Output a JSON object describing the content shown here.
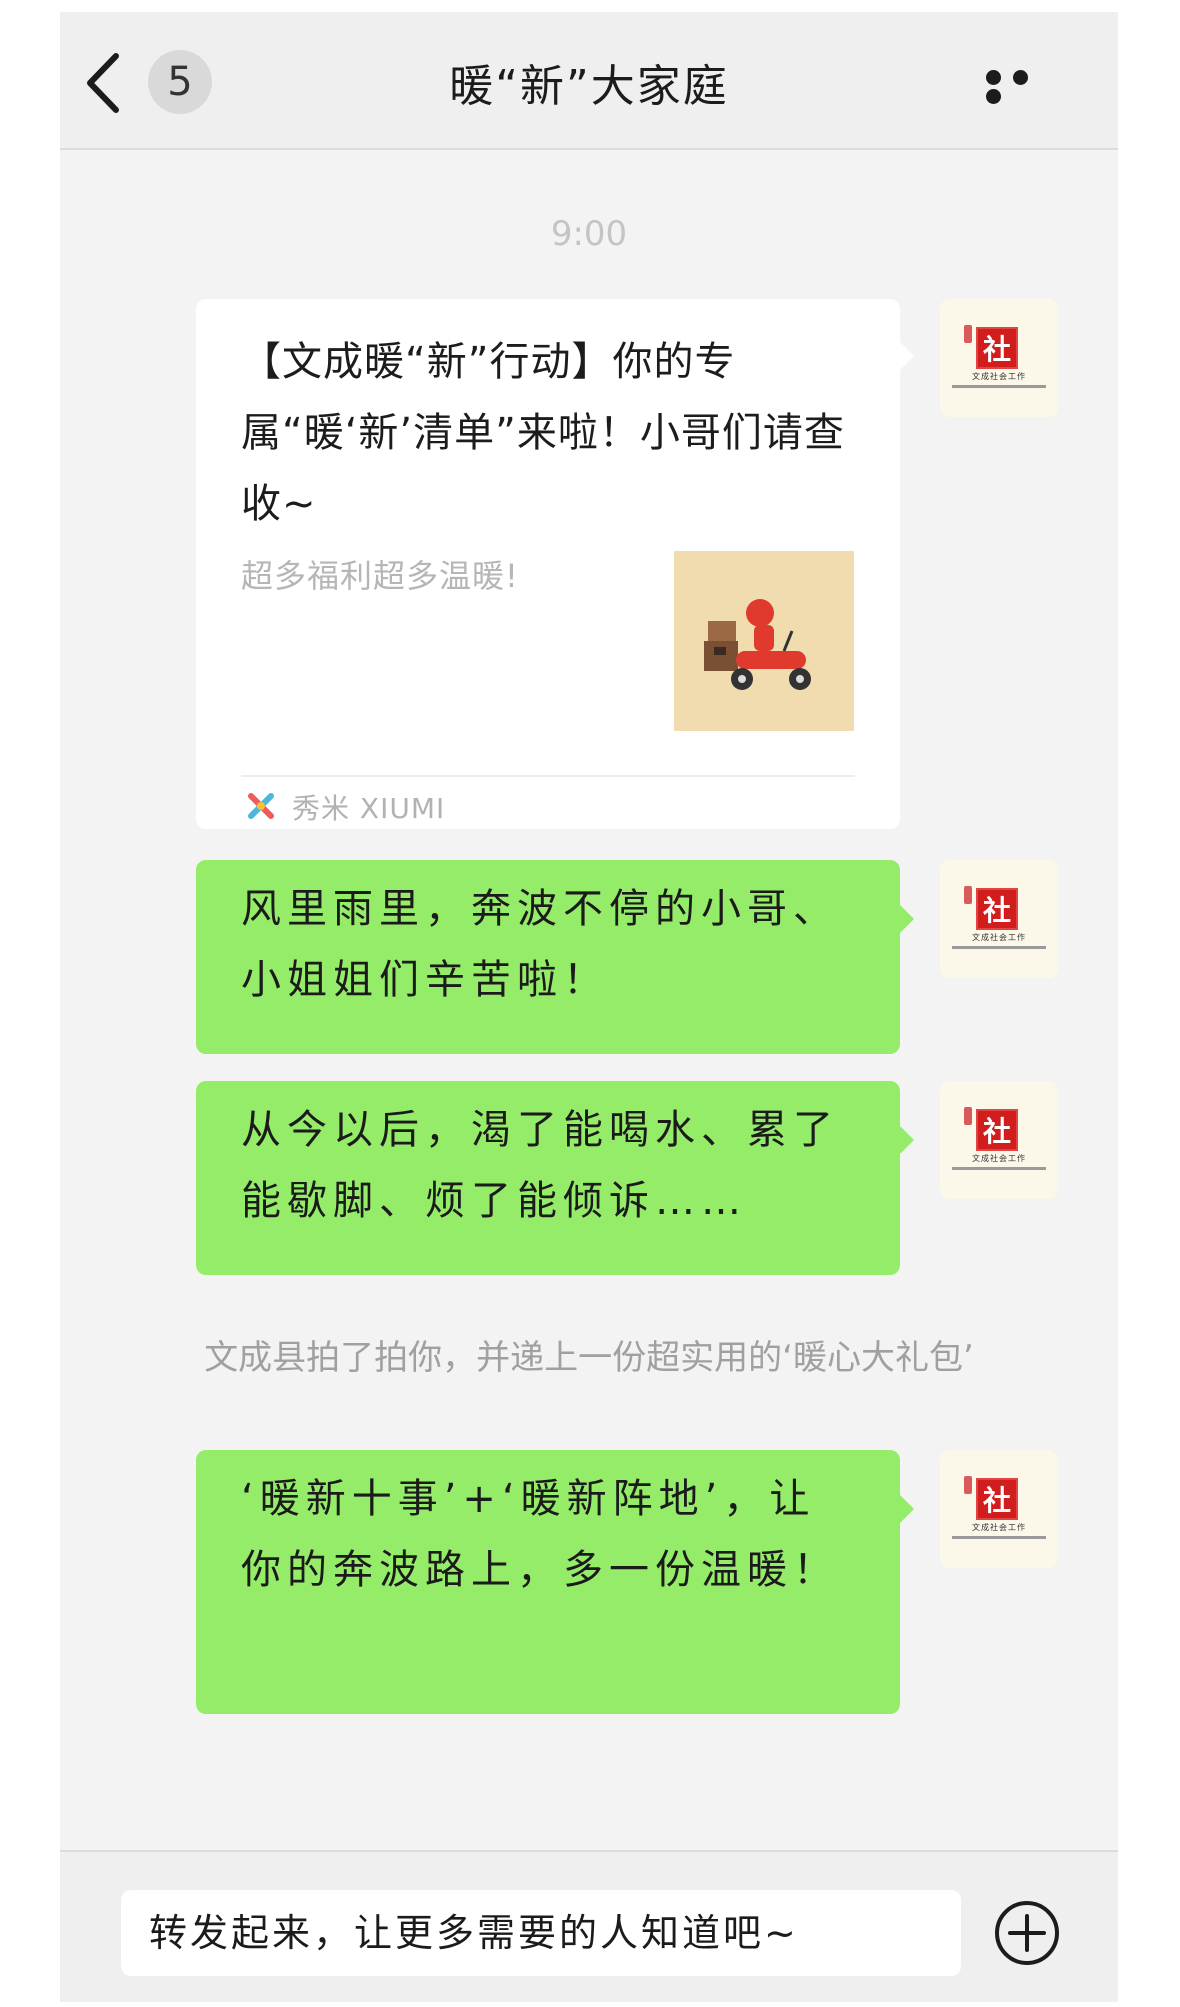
{
  "header": {
    "back_icon": "chevron-left-icon",
    "unread_count": "5",
    "title": "暖“新”大家庭",
    "more_icon": "more-dots-icon"
  },
  "timestamp": "9:00",
  "card": {
    "title": "【文成暖“新”行动】你的专属“暖‘新’清单”来啦！小哥们请查收~",
    "description": "超多福利超多温暖!",
    "source": "秀米 XIUMI",
    "thumbnail_icon": "delivery-scooter-illustration",
    "avatar_text": "社"
  },
  "messages": [
    {
      "text": "风里雨里，奔波不停的小哥、小姐姐们辛苦啦！",
      "avatar_text": "社"
    },
    {
      "text": "从今以后，渴了能喝水、累了能歇脚、烦了能倾诉……",
      "avatar_text": "社"
    },
    {
      "text": "‘暖新十事’+‘暖新阵地’，让你的奔波路上，多一份温暖！",
      "avatar_text": "社"
    }
  ],
  "system_message": "文成县拍了拍你，并递上一份超实用的‘暖心大礼包’",
  "input": {
    "value": "转发起来，让更多需要的人知道吧~",
    "plus_icon": "add-circle-icon"
  },
  "colors": {
    "outgoing_bubble": "#95ec69",
    "background": "#f3f3f3",
    "header": "#efefef"
  }
}
